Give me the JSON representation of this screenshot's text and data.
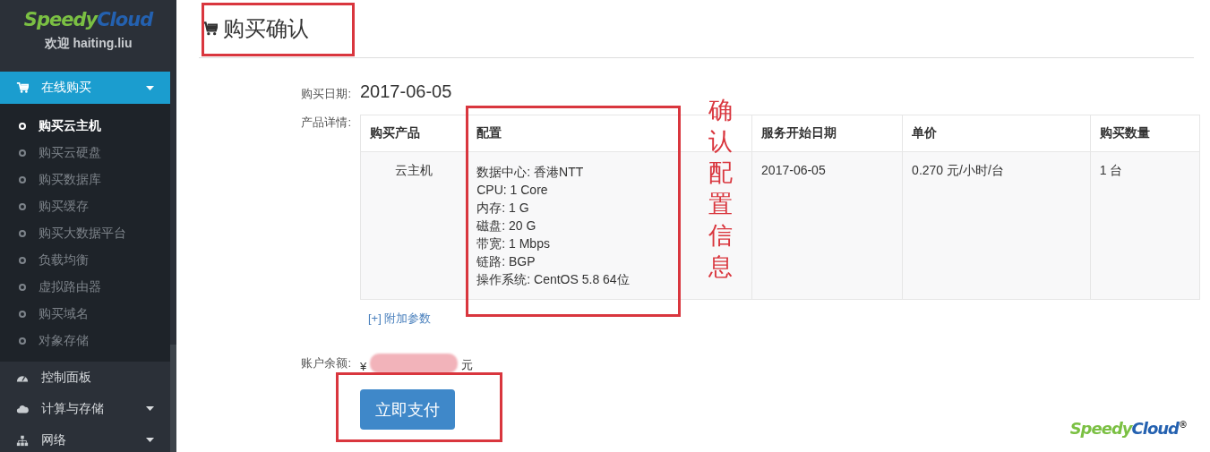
{
  "sidebar": {
    "logo": {
      "first": "Speedy",
      "second": "Cloud"
    },
    "welcome": "欢迎 haiting.liu",
    "menu": [
      {
        "label": "在线购买",
        "kind": "cart",
        "has_caret": true,
        "selected": true,
        "expanded": true,
        "children": [
          {
            "label": "购买云主机",
            "selected": true
          },
          {
            "label": "购买云硬盘",
            "selected": false
          },
          {
            "label": "购买数据库",
            "selected": false
          },
          {
            "label": "购买缓存",
            "selected": false
          },
          {
            "label": "购买大数据平台",
            "selected": false
          },
          {
            "label": "负载均衡",
            "selected": false
          },
          {
            "label": "虚拟路由器",
            "selected": false
          },
          {
            "label": "购买域名",
            "selected": false
          },
          {
            "label": "对象存储",
            "selected": false
          }
        ]
      },
      {
        "label": "控制面板",
        "kind": "gauge",
        "has_caret": false,
        "selected": false,
        "expanded": false
      },
      {
        "label": "计算与存储",
        "kind": "cloud",
        "has_caret": true,
        "selected": false,
        "expanded": false
      },
      {
        "label": "网络",
        "kind": "network",
        "has_caret": true,
        "selected": false,
        "expanded": false
      }
    ]
  },
  "page": {
    "title": "购买确认",
    "date_label": "购买日期:",
    "date": "2017-06-05",
    "details_label": "产品详情:",
    "table": {
      "columns": [
        "购买产品",
        "配置",
        "服务开始日期",
        "单价",
        "购买数量"
      ],
      "rows": [
        {
          "product": "云主机",
          "config": [
            "数据中心: 香港NTT",
            "CPU: 1 Core",
            "内存: 1 G",
            "磁盘: 20 G",
            "带宽: 1 Mbps",
            "链路: BGP",
            "操作系统: CentOS 5.8 64位"
          ],
          "start_date": "2017-06-05",
          "price": "0.270 元/小时/台",
          "quantity": "1 台"
        }
      ]
    },
    "extra_link": "[+] 附加参数",
    "balance_label": "账户余额:",
    "currency": "¥",
    "unit": "元",
    "pay_button": "立即支付",
    "footer_logo": {
      "first": "Speedy",
      "second": "Cloud",
      "mark": "®"
    }
  },
  "annotation": {
    "note": "确认配置信息"
  }
}
